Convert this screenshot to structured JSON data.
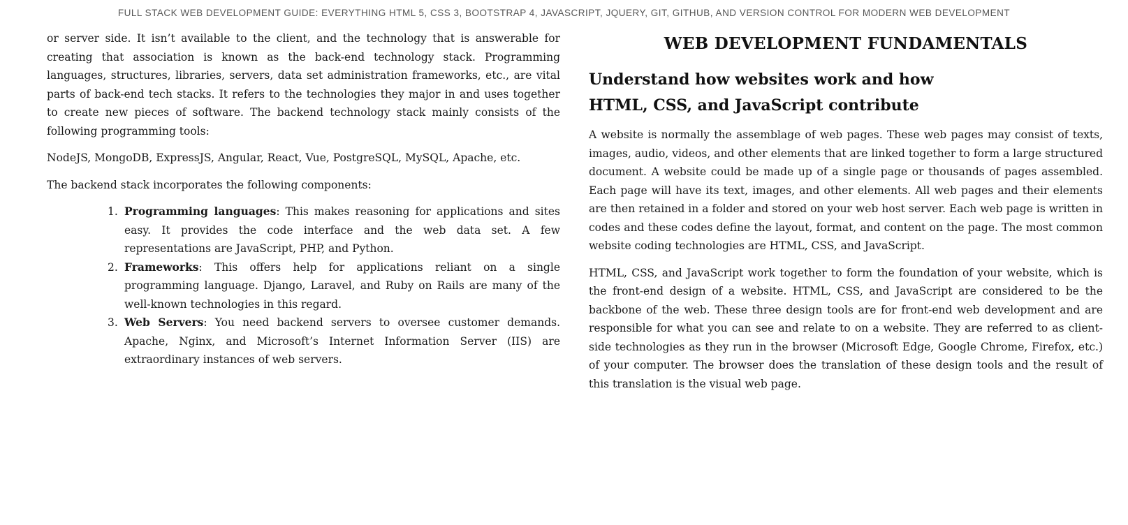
{
  "running_header": "FULL STACK WEB DEVELOPMENT GUIDE: EVERYTHING HTML 5, CSS 3, BOOTSTRAP 4, JAVASCRIPT, JQUERY, GIT, GITHUB, AND VERSION CONTROL FOR MODERN WEB DEVELOPMENT",
  "left_column": {
    "intro_paragraph": "or server side. It isn’t available to the client, and the technology that is answerable for creating that association is known as the back-end technology stack. Programming languages, structures, libraries, servers, data set administration frameworks, etc., are vital parts of back-end tech stacks. It refers to the technologies they major in and uses together to create new pieces of software. The backend technology stack mainly consists of the following programming tools:",
    "tools_line": "NodeJS, MongoDB, ExpressJS, Angular, React, Vue, PostgreSQL, MySQL, Apache, etc.",
    "components_intro": "The backend stack incorporates the following components:",
    "components": [
      {
        "number": "1.",
        "term": "Programming languages",
        "text": ": This makes reasoning for applications and sites easy. It provides the code interface and the web data set. A few representations are JavaScript, PHP, and Python."
      },
      {
        "number": "2.",
        "term": "Frameworks",
        "text": ": This offers help for applications reliant on a single programming language. Django, Laravel, and Ruby on Rails are many of the well-known technologies in this regard."
      },
      {
        "number": "3.",
        "term": "Web Servers",
        "text": ": You need backend servers to oversee customer demands. Apache, Nginx, and Microsoft’s Internet Information Server (IIS) are extraordinary instances of web servers."
      }
    ]
  },
  "right_column": {
    "section_title": "WEB DEVELOPMENT FUNDAMENTALS",
    "subsection_title": "Understand how websites work and how HTML, CSS, and JavaScript contribute",
    "paragraph_1": "A website is normally the assemblage of web pages. These web pages may consist of texts, images, audio, videos, and other elements that are linked together to form a large structured document. A website could be made up of a single page or thousands of pages assembled. Each page will have its text, images, and other elements. All web pages and their elements are then retained in a folder and stored on your web host server. Each web page is written in codes and these codes define the layout, format, and content on the page. The most common website coding technologies are HTML, CSS, and JavaScript.",
    "paragraph_2": "HTML, CSS, and JavaScript work together to form the foundation of your website, which is the front-end design of a website. HTML, CSS, and JavaScript are considered to be the backbone of the web. These three design tools are for front-end web development and are responsible for what you can see and relate to on a website. They are referred to as client-side technologies as they run in the browser (Microsoft Edge, Google Chrome, Firefox, etc.) of your computer. The browser does the translation of these design tools and the result of this translation is the visual web page."
  }
}
